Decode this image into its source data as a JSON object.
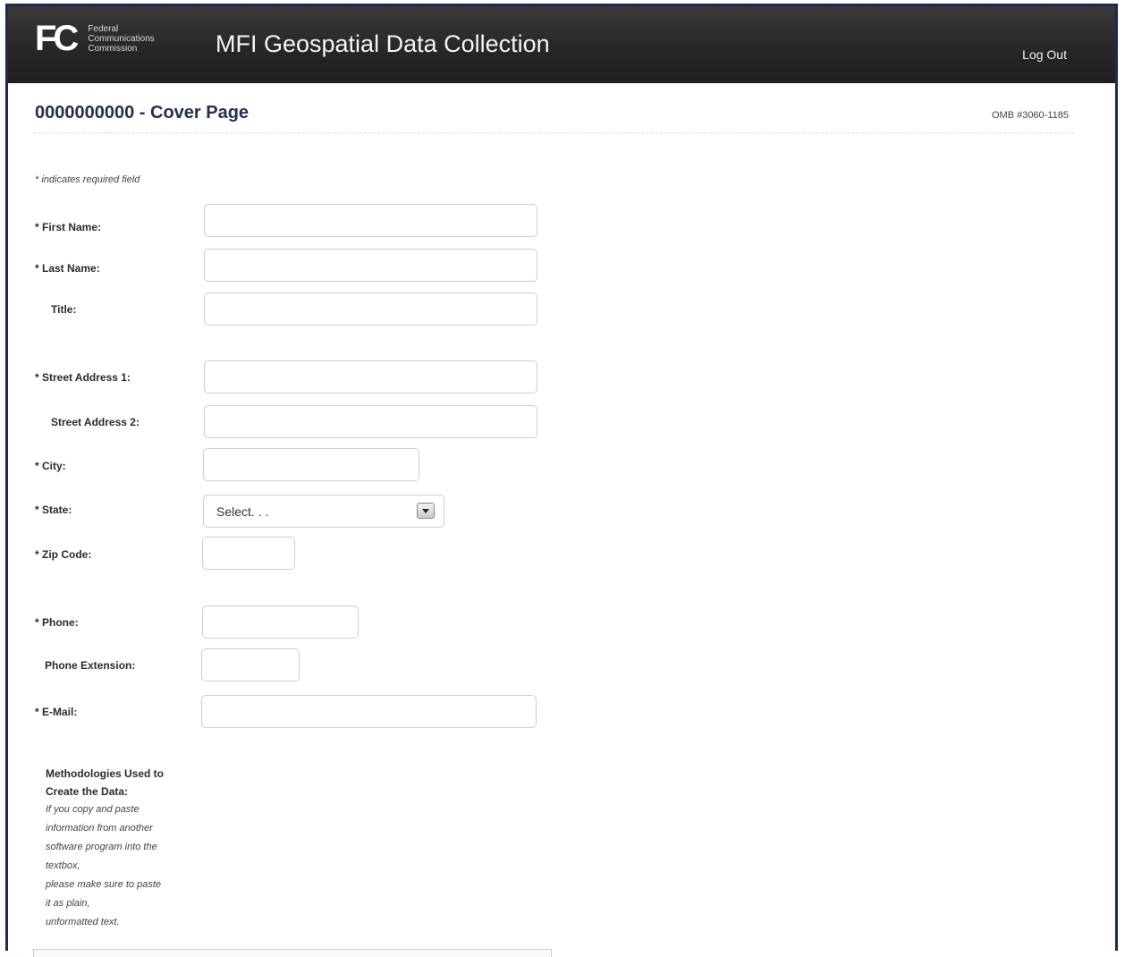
{
  "header": {
    "logo_mark": "FC",
    "logo_lines": [
      "Federal",
      "Communications",
      "Commission"
    ],
    "app_title": "MFI Geospatial Data Collection",
    "logout": "Log Out"
  },
  "page": {
    "title": "0000000000 - Cover Page",
    "omb": "OMB #3060-1185",
    "required_note": "* indicates required field"
  },
  "form": {
    "first_name_label": "* First Name:",
    "last_name_label": "* Last Name:",
    "title_label": "Title:",
    "street1_label": "* Street Address 1:",
    "street2_label": "Street Address 2:",
    "city_label": "* City:",
    "state_label": "* State:",
    "state_value": "Select. . .",
    "zip_label": "* Zip Code:",
    "phone_label": "* Phone:",
    "phone_ext_label": "Phone Extension:",
    "email_label": "* E-Mail:"
  },
  "methodologies": {
    "title_lines": [
      "Methodologies Used to",
      "Create the Data:"
    ],
    "help_lines": [
      "If you copy and paste",
      "information from another",
      "software program into the",
      "textbox,",
      "please make sure to paste",
      "it as plain,",
      "unformatted text."
    ]
  }
}
